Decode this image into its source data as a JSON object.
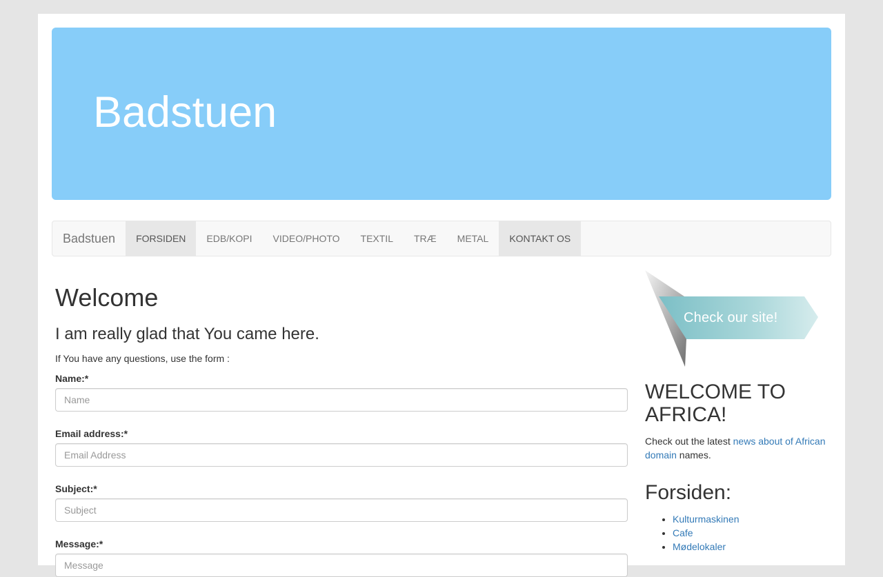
{
  "header": {
    "title": "Badstuen"
  },
  "nav": {
    "brand": "Badstuen",
    "items": [
      {
        "label": "FORSIDEN",
        "active": true
      },
      {
        "label": "EDB/KOPI",
        "active": false
      },
      {
        "label": "VIDEO/PHOTO",
        "active": false
      },
      {
        "label": "TEXTIL",
        "active": false
      },
      {
        "label": "TRÆ",
        "active": false
      },
      {
        "label": "METAL",
        "active": false
      },
      {
        "label": "KONTAKT OS",
        "active": true
      }
    ]
  },
  "main": {
    "title": "Welcome",
    "subtitle": "I am really glad that You came here.",
    "intro": "If You have any questions, use the form :",
    "form": {
      "name_label": "Name:*",
      "name_placeholder": "Name",
      "email_label": "Email address:*",
      "email_placeholder": "Email Address",
      "subject_label": "Subject:*",
      "subject_placeholder": "Subject",
      "message_label": "Message:*",
      "message_placeholder": "Message"
    }
  },
  "sidebar": {
    "banner_text": "Check our site!",
    "africa_title": "WELCOME TO AFRICA!",
    "africa_text_before": "Check out the latest ",
    "africa_link": "news about of African domain",
    "africa_text_after": " names.",
    "section_title": "Forsiden:",
    "links": [
      "Kulturmaskinen",
      "Cafe",
      "Mødelokaler"
    ]
  },
  "colors": {
    "jumbotron_bg": "#87cdf9",
    "link": "#337ab7",
    "banner_ribbon": "#9fd1d6"
  }
}
